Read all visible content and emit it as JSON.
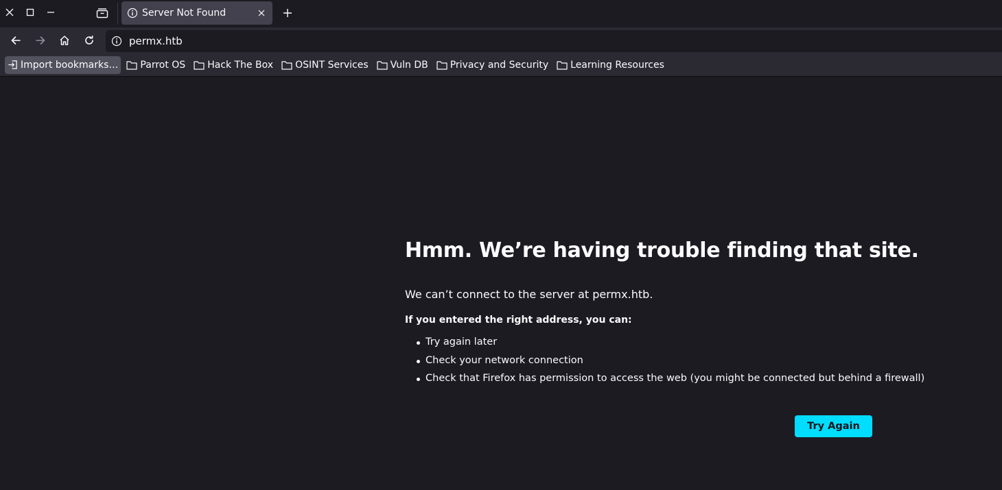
{
  "window": {
    "close_icon": "close-icon",
    "maximize_icon": "maximize-icon",
    "minimize_icon": "minimize-icon"
  },
  "tabs": [
    {
      "title": "Server Not Found",
      "icon": "info-icon",
      "active": true
    }
  ],
  "nav": {
    "url": "permx.htb"
  },
  "bookmarks": [
    {
      "label": "Import bookmarks…",
      "icon": "import-icon"
    },
    {
      "label": "Parrot OS",
      "icon": "folder-icon"
    },
    {
      "label": "Hack The Box",
      "icon": "folder-icon"
    },
    {
      "label": "OSINT Services",
      "icon": "folder-icon"
    },
    {
      "label": "Vuln DB",
      "icon": "folder-icon"
    },
    {
      "label": "Privacy and Security",
      "icon": "folder-icon"
    },
    {
      "label": "Learning Resources",
      "icon": "folder-icon"
    }
  ],
  "error": {
    "title": "Hmm. We’re having trouble finding that site.",
    "description": "We can’t connect to the server at permx.htb.",
    "hint": "If you entered the right address, you can:",
    "suggestions": [
      "Try again later",
      "Check your network connection",
      "Check that Firefox has permission to access the web (you might be connected but behind a firewall)"
    ],
    "button_label": "Try Again"
  },
  "colors": {
    "accent": "#00ddff",
    "background": "#1c1b22",
    "toolbar": "#2b2a33",
    "active_tab": "#42414d"
  }
}
